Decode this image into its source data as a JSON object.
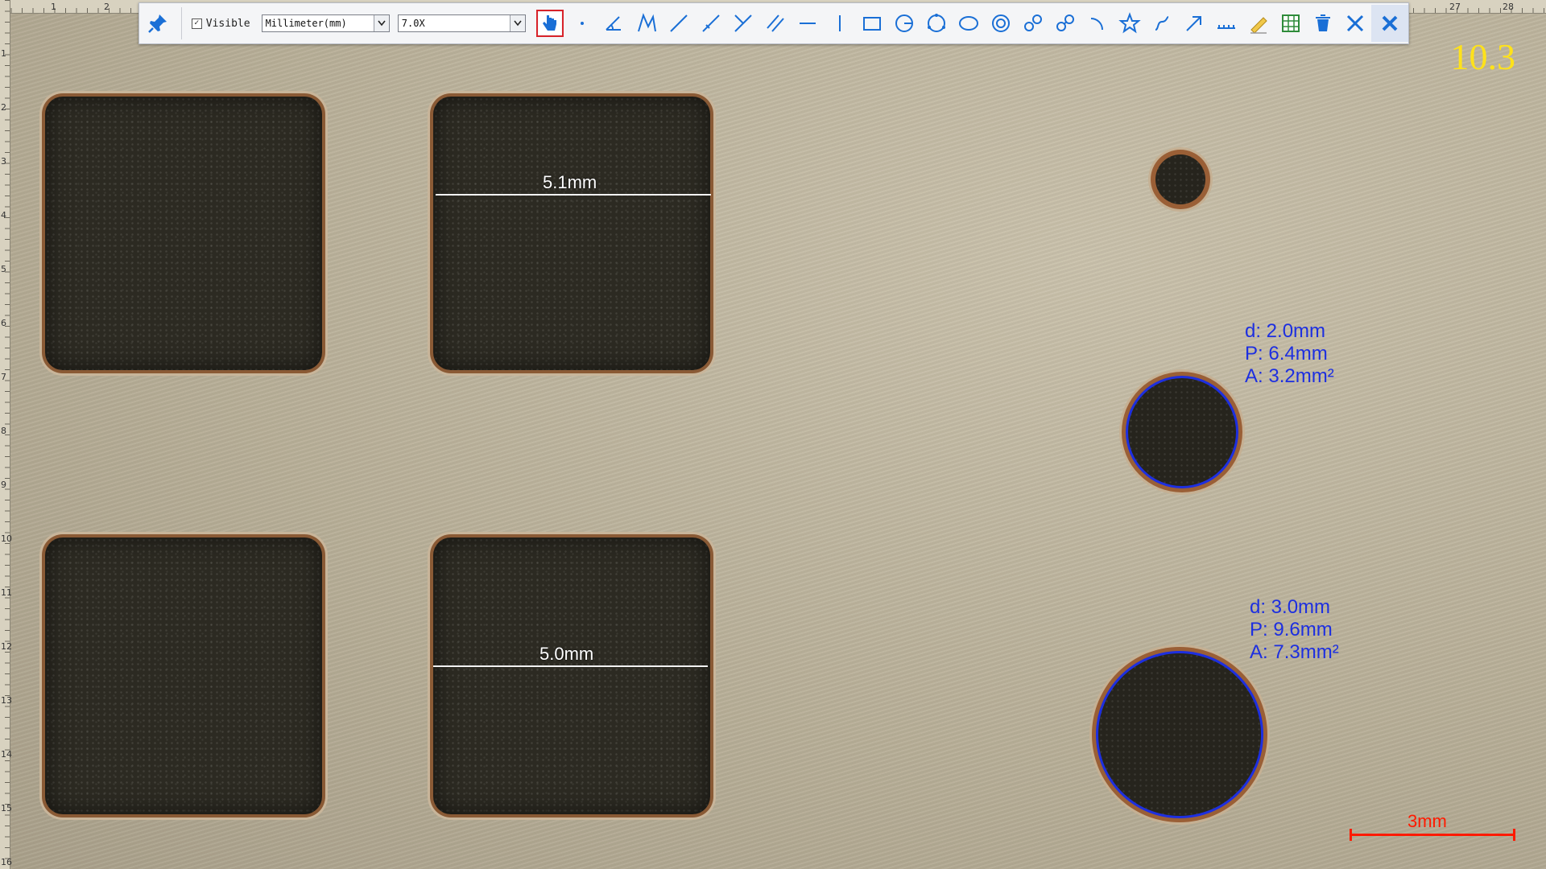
{
  "toolbar": {
    "visible_checkbox": {
      "label": "Visible",
      "checked": true
    },
    "unit_select": {
      "value": "Millimeter(mm)"
    },
    "zoom_select": {
      "value": "7.0X"
    },
    "tools": [
      {
        "icon": "hand-pointer-icon",
        "active": true
      },
      {
        "icon": "point-icon"
      },
      {
        "icon": "angle-icon"
      },
      {
        "icon": "polyline-icon"
      },
      {
        "icon": "line-icon"
      },
      {
        "icon": "arbitrary-line-icon"
      },
      {
        "icon": "vertical-lines-icon"
      },
      {
        "icon": "parallel-lines-icon"
      },
      {
        "icon": "horizontal-line-icon"
      },
      {
        "icon": "vertical-line-icon"
      },
      {
        "icon": "rectangle-icon"
      },
      {
        "icon": "circle-radius-icon"
      },
      {
        "icon": "circle-3point-icon"
      },
      {
        "icon": "ellipse-icon"
      },
      {
        "icon": "concentric-circles-icon"
      },
      {
        "icon": "two-circles-distance-icon"
      },
      {
        "icon": "circle-link-icon"
      },
      {
        "icon": "arc-icon"
      },
      {
        "icon": "polygon-star-icon"
      },
      {
        "icon": "curve-icon"
      },
      {
        "icon": "arrow-icon"
      },
      {
        "icon": "scale-ruler-icon"
      },
      {
        "icon": "text-annotation-icon"
      },
      {
        "icon": "export-excel-icon"
      },
      {
        "icon": "delete-icon"
      },
      {
        "icon": "clear-all-icon"
      },
      {
        "icon": "close-icon"
      }
    ]
  },
  "rulers": {
    "top_labels": [
      "1",
      "2",
      "27",
      "28"
    ],
    "left_labels": [
      "1",
      "2",
      "3",
      "4",
      "5",
      "6",
      "7",
      "8",
      "9",
      "10",
      "11",
      "12",
      "13",
      "14",
      "15",
      "16"
    ]
  },
  "zoom_indicator": "10.3",
  "measurements": {
    "line_top": "5.1mm",
    "line_bottom": "5.0mm",
    "circle_small": {
      "d": "d: 2.0mm",
      "p": "P: 6.4mm",
      "a": "A: 3.2mm²"
    },
    "circle_large": {
      "d": "d: 3.0mm",
      "p": "P: 9.6mm",
      "a": "A: 7.3mm²"
    }
  },
  "scale_bar": {
    "label": "3mm"
  },
  "colors": {
    "measure_blue": "#1d2fe0",
    "scale_red": "#ff1a00",
    "zoom_yellow": "#ffe21a",
    "accent_blue": "#1a6fd6"
  }
}
